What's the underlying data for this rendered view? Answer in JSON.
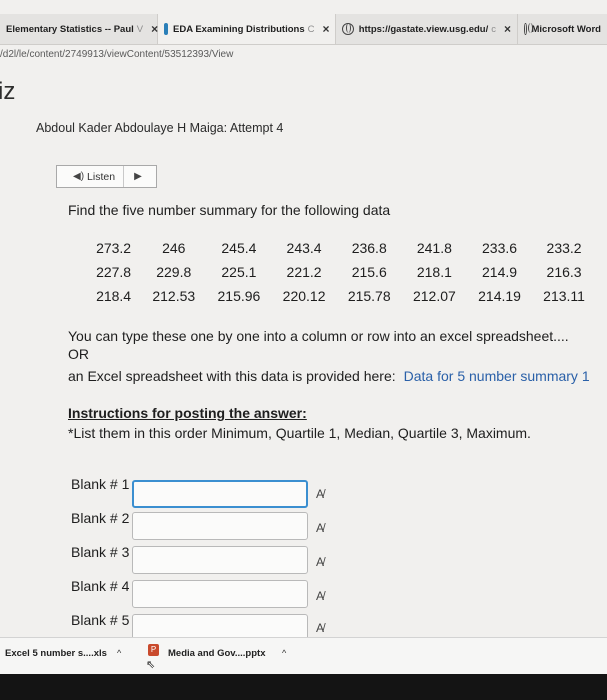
{
  "tabs": [
    {
      "title": "Elementary Statistics -- Paul",
      "faded": "V",
      "close": "×"
    },
    {
      "title": "EDA Examining Distributions",
      "faded": "C",
      "close": "×"
    },
    {
      "title": "https://gastate.view.usg.edu/",
      "faded": "c",
      "close": "×"
    },
    {
      "title": "Microsoft Word",
      "faded": "",
      "close": ""
    }
  ],
  "url": "/d2l/le/content/2749913/viewContent/53512393/View",
  "page": {
    "heading": "iz",
    "attempt": "Abdoul Kader Abdoulaye H Maiga: Attempt 4",
    "listen_label": "Listen",
    "speaker_icon": "◀)",
    "play_icon": "▶",
    "question": "Find the five number summary for the following data",
    "data_rows": [
      [
        "273.2",
        "246",
        "245.4",
        "243.4",
        "236.8",
        "241.8",
        "233.6",
        "233.2"
      ],
      [
        "227.8",
        "229.8",
        "225.1",
        "221.2",
        "215.6",
        "218.1",
        "214.9",
        "216.3"
      ],
      [
        "218.4",
        "212.53",
        "215.96",
        "220.12",
        "215.78",
        "212.07",
        "214.19",
        "213.11"
      ]
    ],
    "para1": "You can type these one by one into a column or row into an excel spreadsheet....",
    "para2": "OR",
    "para3": "an Excel spreadsheet with this data is provided here:",
    "data_link": "Data for 5 number summary 1",
    "instructions_heading": "Instructions for posting the answer:",
    "instructions_body": "*List them in this order Minimum, Quartile 1, Median, Quartile 3, Maximum.",
    "blanks": [
      {
        "label": "Blank # 1",
        "value": ""
      },
      {
        "label": "Blank # 2",
        "value": ""
      },
      {
        "label": "Blank # 3",
        "value": ""
      },
      {
        "label": "Blank # 4",
        "value": ""
      },
      {
        "label": "Blank # 5",
        "value": ""
      }
    ],
    "spellcheck_icon": "A̸"
  },
  "downloads": [
    {
      "name": "Excel 5 number s....xls",
      "caret": "^"
    },
    {
      "name": "Media and Gov....pptx",
      "caret": "^"
    }
  ],
  "colors": {
    "link": "#2a60a8",
    "focus": "#3b8fd0"
  }
}
